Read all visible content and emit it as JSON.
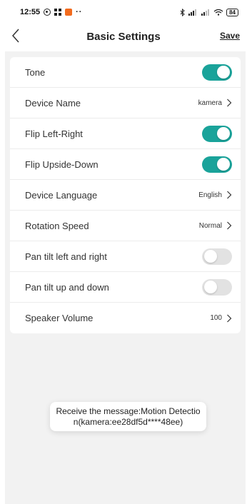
{
  "status_bar": {
    "time": "12:55",
    "dots": "··",
    "battery": "84"
  },
  "header": {
    "title": "Basic Settings",
    "save_label": "Save"
  },
  "settings": [
    {
      "label": "Tone",
      "type": "toggle",
      "on": true
    },
    {
      "label": "Device Name",
      "type": "link",
      "value": "kamera"
    },
    {
      "label": "Flip Left-Right",
      "type": "toggle",
      "on": true
    },
    {
      "label": "Flip Upside-Down",
      "type": "toggle",
      "on": true
    },
    {
      "label": "Device Language",
      "type": "link",
      "value": "English"
    },
    {
      "label": "Rotation Speed",
      "type": "link",
      "value": "Normal"
    },
    {
      "label": "Pan tilt left and right",
      "type": "toggle",
      "on": false
    },
    {
      "label": "Pan tilt up and down",
      "type": "toggle",
      "on": false
    },
    {
      "label": "Speaker Volume",
      "type": "link",
      "value": "100"
    }
  ],
  "toast": {
    "message": "Receive the message:Motion Detection(kamera:ee28df5d****48ee)"
  },
  "colors": {
    "toggle_on": "#1aa39a",
    "toggle_off": "#e2e2e2",
    "background": "#f2f2f2"
  }
}
